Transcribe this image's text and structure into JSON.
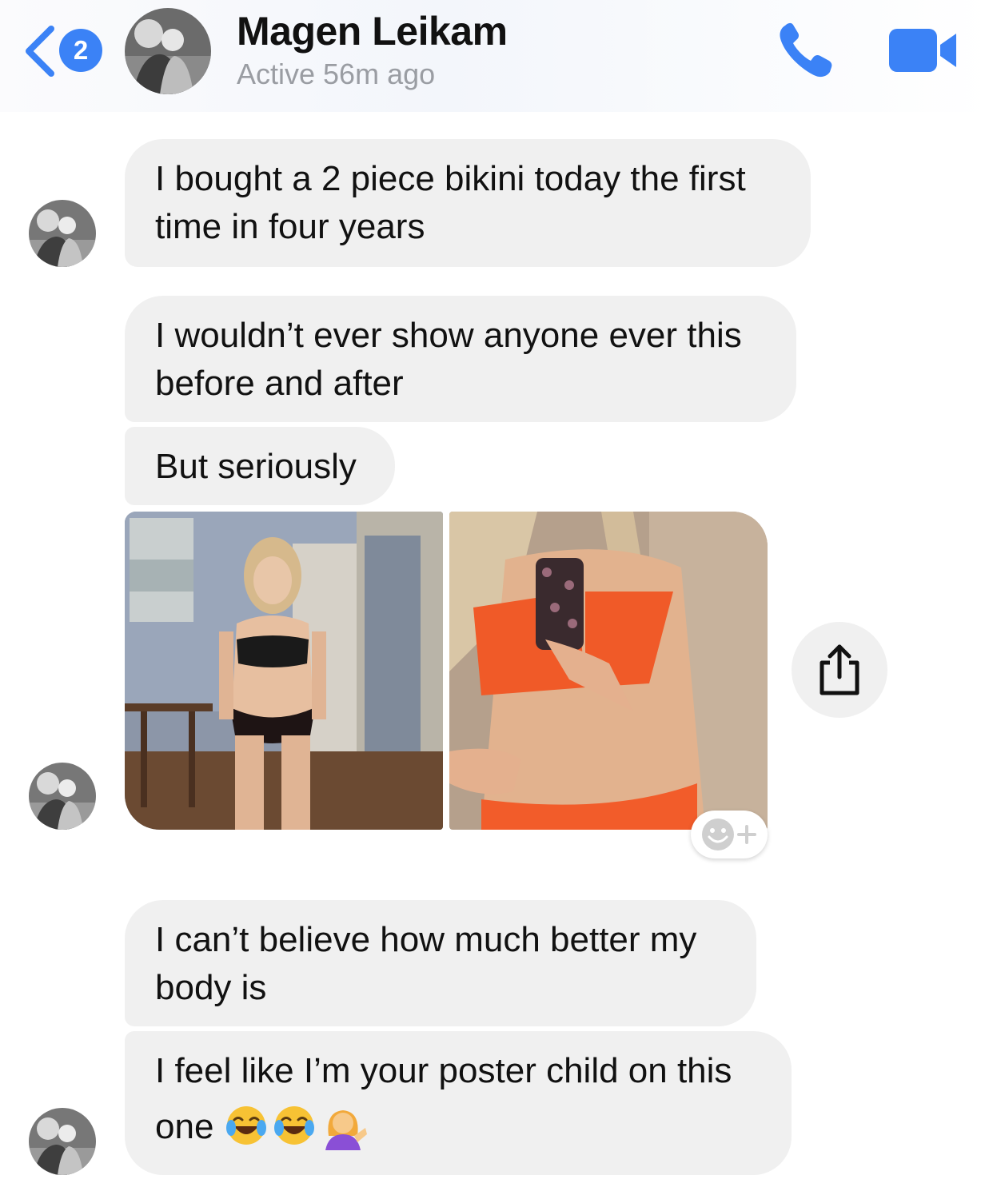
{
  "header": {
    "unread_count": "2",
    "contact_name": "Magen Leikam",
    "status": "Active 56m ago",
    "accent_color": "#3b82f6"
  },
  "messages": [
    {
      "text_line1": "I bought a 2 piece bikini today the first",
      "text_line2": "time in four years"
    },
    {
      "text_line1": "I wouldn’t ever show anyone ever this",
      "text_line2": "before and after"
    },
    {
      "text_line1": "But seriously"
    },
    {
      "text_line1": "I can’t believe how much better my",
      "text_line2": "body is"
    },
    {
      "text_line1": "I feel like I’m your poster child on this",
      "text_line2": "one"
    }
  ],
  "icons": {
    "back": "chevron-left-icon",
    "call": "phone-icon",
    "video": "video-camera-icon",
    "share": "share-icon",
    "react": "add-reaction-icon",
    "emojis": [
      "tears-of-joy-emoji",
      "tears-of-joy-emoji",
      "person-tipping-hand-emoji"
    ]
  }
}
